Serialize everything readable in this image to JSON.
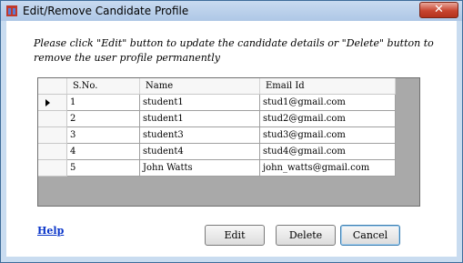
{
  "window": {
    "title": "Edit/Remove Candidate Profile",
    "close_glyph": "✕"
  },
  "instructions": "Please click \"Edit\" button to update the candidate details  or  \"Delete\" button to remove the user profile permanently",
  "grid": {
    "columns": [
      "S.No.",
      "Name",
      "Email Id"
    ],
    "rows": [
      {
        "sno": "1",
        "name": "student1",
        "email": "stud1@gmail.com",
        "current": true
      },
      {
        "sno": "2",
        "name": "student1",
        "email": "stud2@gmail.com",
        "current": false
      },
      {
        "sno": "3",
        "name": "student3",
        "email": "stud3@gmail.com",
        "current": false
      },
      {
        "sno": "4",
        "name": "student4",
        "email": "stud4@gmail.com",
        "current": false
      },
      {
        "sno": "5",
        "name": "John Watts",
        "email": "john_watts@gmail.com",
        "current": false
      }
    ]
  },
  "footer": {
    "help_label": "Help",
    "edit_label": "Edit",
    "delete_label": "Delete",
    "cancel_label": "Cancel"
  },
  "icons": {
    "app": "app-window-icon",
    "current_row": "row-pointer-icon"
  }
}
